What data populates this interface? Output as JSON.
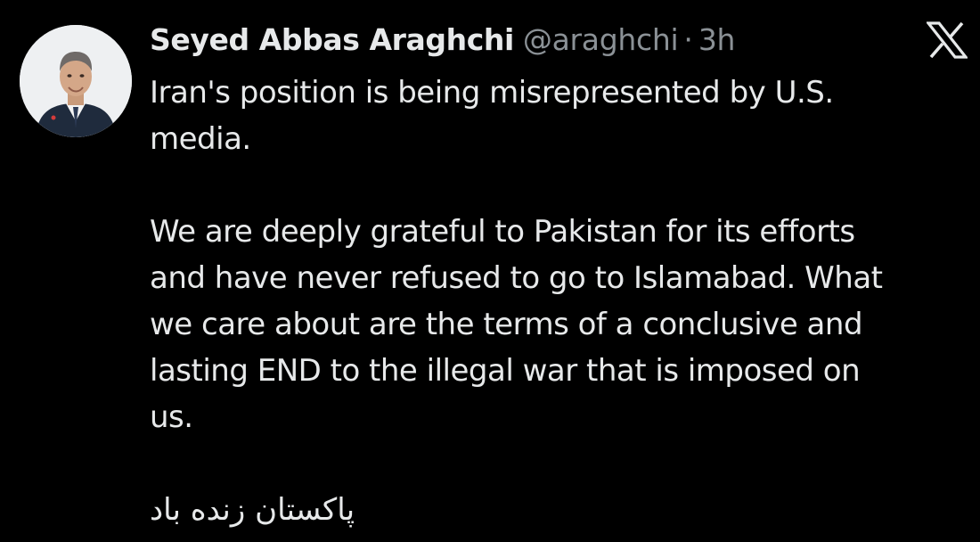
{
  "author": {
    "display_name": "Seyed Abbas Araghchi",
    "handle": "@araghchi",
    "separator": "·",
    "time": "3h",
    "avatar_icon": "profile-photo"
  },
  "header_actions": {
    "logo_icon": "x-logo-icon"
  },
  "tweet": {
    "paragraphs": [
      "Iran's position is being misrepresented by U.S.\nmedia.",
      "We are deeply grateful to Pakistan for its efforts\nand have never refused to go to Islamabad. What\nwe care about are the terms of a conclusive and\nlasting END to the illegal war that is imposed on\nus.",
      "پاکستان زنده باد"
    ]
  },
  "colors": {
    "background": "#000000",
    "text": "#e7e9ea",
    "secondary_text": "#8b9196"
  }
}
